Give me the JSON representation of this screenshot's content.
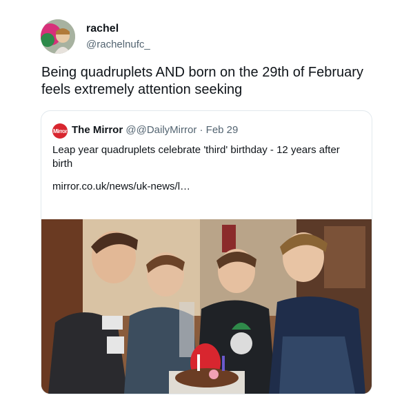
{
  "tweet": {
    "author": {
      "name": "rachel",
      "handle": "@rachelnufc_"
    },
    "text": "Being quadruplets AND born on the 29th of February feels extremely attention seeking"
  },
  "quote": {
    "logo_text": "Mirror",
    "name": "The Mirror",
    "handle": "@@DailyMirror",
    "separator": "·",
    "date": "Feb 29",
    "title": "Leap year quadruplets celebrate 'third' birthday - 12 years after birth",
    "link": "mirror.co.uk/news/uk-news/l…"
  },
  "icons": {
    "logo": "mirror-logo-icon",
    "avatar": "profile-photo"
  },
  "colors": {
    "mirror_red": "#d8262f",
    "handle_gray": "#536471",
    "border": "#e1e8ed"
  }
}
